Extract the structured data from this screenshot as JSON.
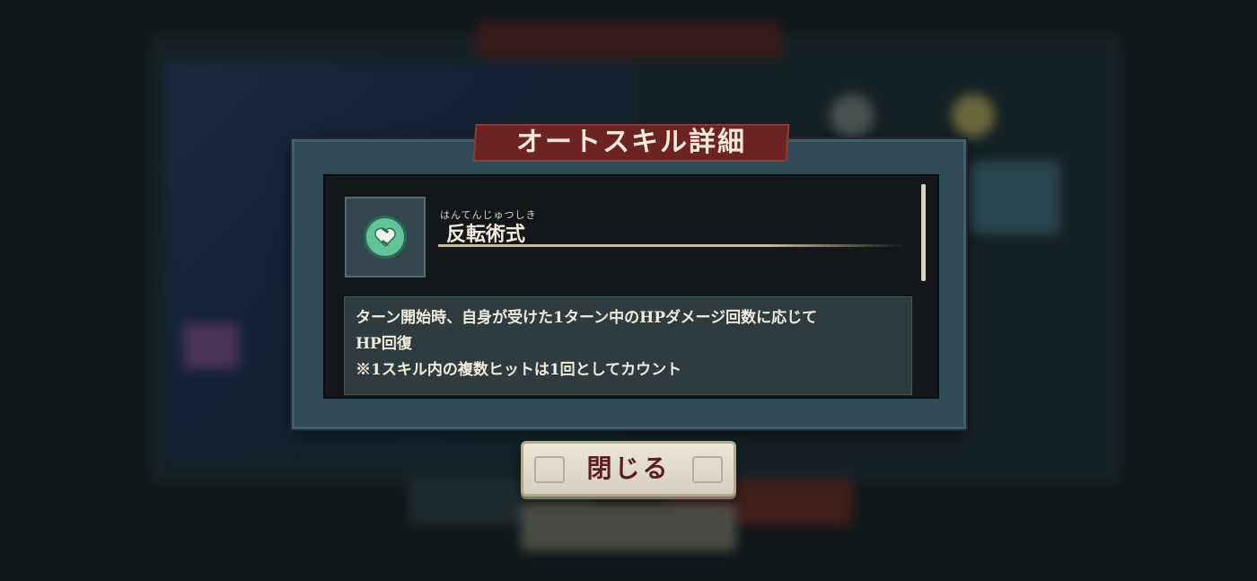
{
  "dialog": {
    "title": "オートスキル詳細",
    "skill": {
      "icon": "heart-bandage-icon",
      "ruby": "はんてんじゅつしき",
      "name": "反転術式"
    },
    "description": {
      "line1": "ターン開始時、自身が受けた1ターン中のHPダメージ回数に応じて",
      "line2": "HP回復",
      "line3": "※1スキル内の複数ヒットは1回としてカウント"
    },
    "close_label": "閉じる"
  },
  "colors": {
    "title_banner": "#6b2421",
    "dialog_frame": "#2e4b56",
    "skill_icon": "#5fc49a",
    "close_text": "#5a1f20"
  }
}
